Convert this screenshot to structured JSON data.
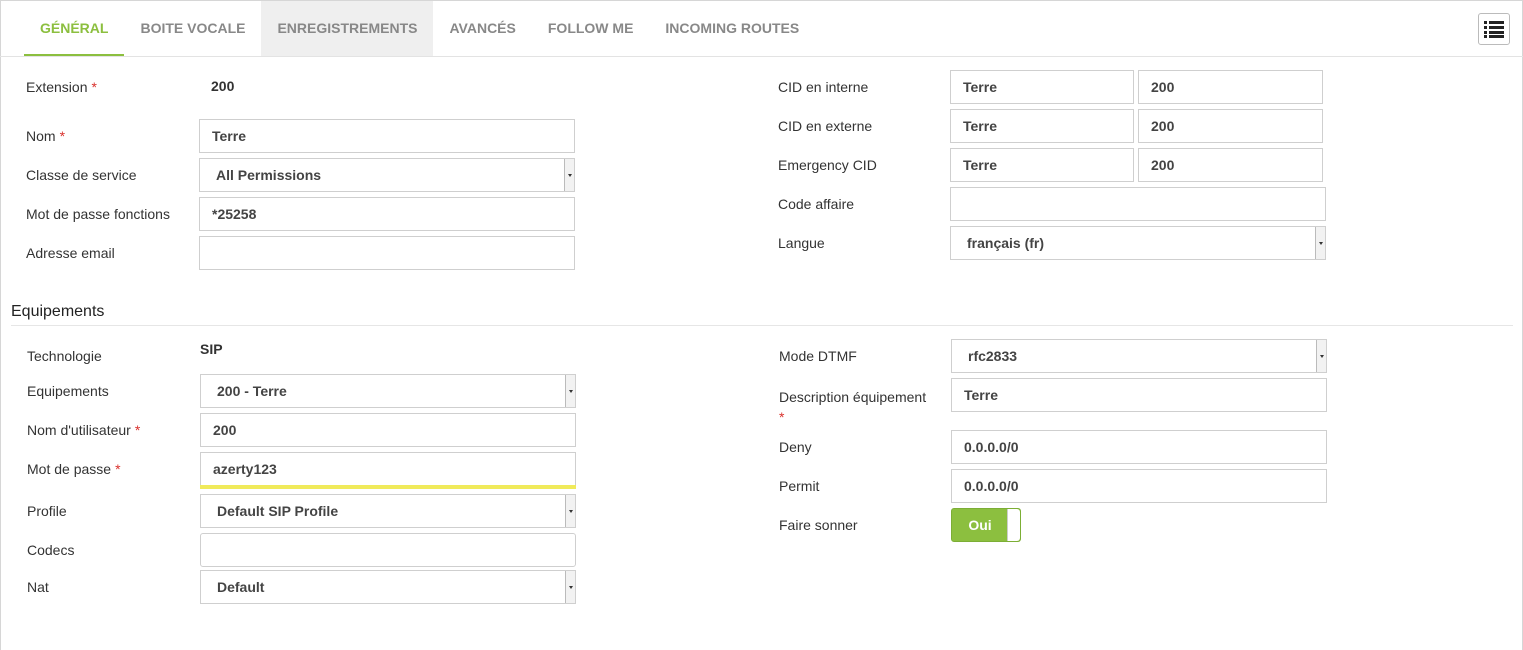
{
  "tabs": [
    {
      "label": "GÉNÉRAL"
    },
    {
      "label": "BOITE VOCALE"
    },
    {
      "label": "ENREGISTREMENTS"
    },
    {
      "label": "AVANCÉS"
    },
    {
      "label": "FOLLOW ME"
    },
    {
      "label": "INCOMING ROUTES"
    }
  ],
  "general": {
    "extension_label": "Extension",
    "extension_value": "200",
    "nom_label": "Nom",
    "nom_value": "Terre",
    "classe_label": "Classe de service",
    "classe_value": "All Permissions",
    "motdepasse_fonctions_label": "Mot de passe fonctions",
    "motdepasse_fonctions_value": "*25258",
    "email_label": "Adresse email",
    "email_value": "",
    "cid_interne_label": "CID en interne",
    "cid_interne_name": "Terre",
    "cid_interne_num": "200",
    "cid_externe_label": "CID en externe",
    "cid_externe_name": "Terre",
    "cid_externe_num": "200",
    "emergency_label": "Emergency CID",
    "emergency_name": "Terre",
    "emergency_num": "200",
    "code_affaire_label": "Code affaire",
    "code_affaire_value": "",
    "langue_label": "Langue",
    "langue_value": "français (fr)"
  },
  "equipements": {
    "section_title": "Equipements",
    "technologie_label": "Technologie",
    "technologie_value": "SIP",
    "equipements_label": "Equipements",
    "equipements_value": "200 - Terre",
    "username_label": "Nom d'utilisateur",
    "username_value": "200",
    "password_label": "Mot de passe",
    "password_value": "azerty123",
    "profile_label": "Profile",
    "profile_value": "Default SIP Profile",
    "codecs_label": "Codecs",
    "codecs_value": "",
    "nat_label": "Nat",
    "nat_value": "Default",
    "dtmf_label": "Mode DTMF",
    "dtmf_value": "rfc2833",
    "description_label": "Description équipement",
    "description_value": "Terre",
    "deny_label": "Deny",
    "deny_value": "0.0.0.0/0",
    "permit_label": "Permit",
    "permit_value": "0.0.0.0/0",
    "ring_label": "Faire sonner",
    "ring_value": "Oui"
  },
  "required_mark": "*",
  "colors": {
    "accent": "#8cbf3f",
    "required": "#d9302c",
    "password_strength": "#f0ea5a"
  },
  "icons": {
    "menu": "list-icon"
  }
}
